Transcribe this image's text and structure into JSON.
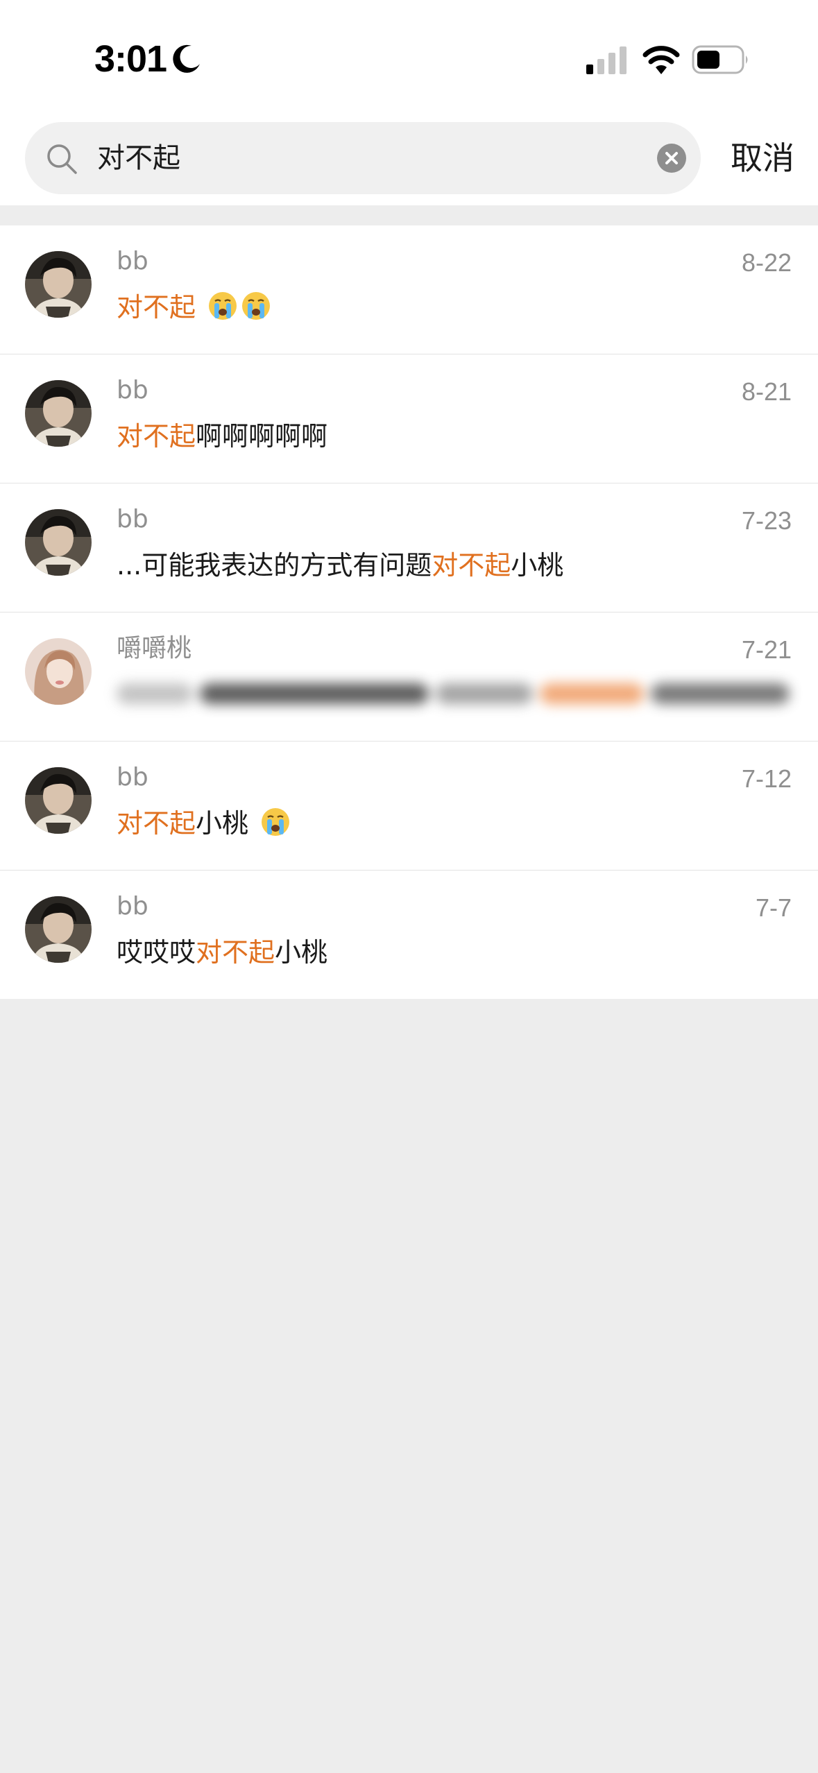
{
  "status_bar": {
    "time": "3:01",
    "icons": [
      "moon-icon",
      "cellular-signal-icon",
      "wifi-icon",
      "battery-icon"
    ]
  },
  "search": {
    "query": "对不起",
    "cancel_label": "取消"
  },
  "colors": {
    "highlight": "#e0701f",
    "name_gray": "#8f8f8f",
    "page_background": "#ededed"
  },
  "results": [
    {
      "name": "bb",
      "date": "8-22",
      "message": {
        "before": "",
        "match": "对不起",
        "after": ""
      },
      "emojis": [
        "crying-face-emoji",
        "crying-face-emoji"
      ]
    },
    {
      "name": "bb",
      "date": "8-21",
      "message": {
        "before": "",
        "match": "对不起",
        "after": "啊啊啊啊啊"
      },
      "emojis": []
    },
    {
      "name": "bb",
      "date": "7-23",
      "message": {
        "before": "...可能我表达的方式有问题",
        "match": "对不起",
        "after": "小桃"
      },
      "emojis": []
    },
    {
      "name": "嚼嚼桃",
      "date": "7-21",
      "message_blurred": true
    },
    {
      "name": "bb",
      "date": "7-12",
      "message": {
        "before": "",
        "match": "对不起",
        "after": "小桃"
      },
      "emojis": [
        "crying-face-emoji"
      ]
    },
    {
      "name": "bb",
      "date": "7-7",
      "message": {
        "before": "哎哎哎",
        "match": "对不起",
        "after": "小桃"
      },
      "emojis": []
    }
  ]
}
